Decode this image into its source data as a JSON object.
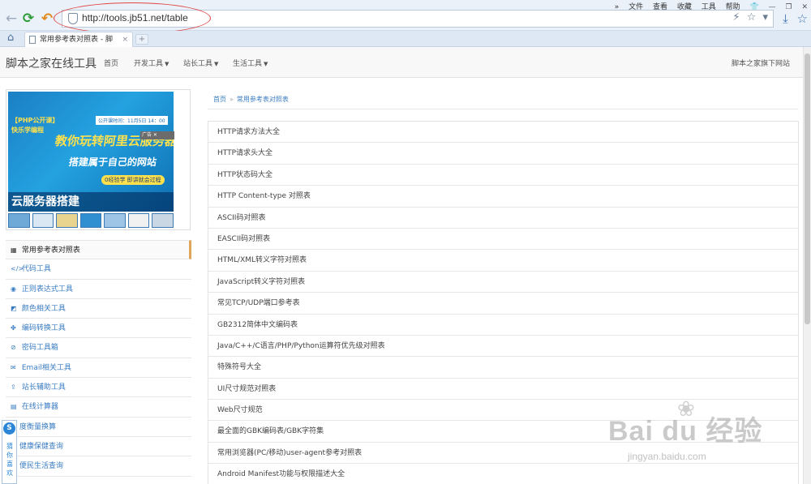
{
  "browser": {
    "url": "http://tools.jb51.net/table",
    "menu": [
      "文件",
      "查看",
      "收藏",
      "工具",
      "帮助"
    ],
    "menu_prefix": "»",
    "tab_title": "常用参考表对照表 - 脚",
    "tab_close": "×",
    "new_tab": "+",
    "icons": {
      "back": "←",
      "refresh": "⟳",
      "undo": "↶",
      "home": "⌂",
      "bolt": "⚡",
      "star": "☆",
      "dropdown": "▾",
      "download": "⤓",
      "favorites": "☆",
      "shirt": "👕",
      "minimize": "—",
      "restore": "❐",
      "close": "✕"
    }
  },
  "site": {
    "brand": "脚本之家在线工具",
    "nav": [
      "首页",
      "开发工具",
      "站长工具",
      "生活工具"
    ],
    "header_right": "脚本之家旗下网站"
  },
  "ad": {
    "tag_line1": "【PHP公开课】",
    "tag_line2": "快乐学编程",
    "date": "公开课时间：11月5日 14：00",
    "headline": "教你玩转阿里云服务器",
    "subline": "搭建属于自己的网站",
    "pill": "0经验学 即讲就会过程",
    "caption": "云服务器搭建",
    "badge": "广告 ✕"
  },
  "sidebar": {
    "items": [
      {
        "icon": "▦",
        "label": "常用参考表对照表"
      },
      {
        "icon": "</>",
        "label": "代码工具"
      },
      {
        "icon": "◉",
        "label": "正则表达式工具"
      },
      {
        "icon": "◩",
        "label": "颜色相关工具"
      },
      {
        "icon": "✤",
        "label": "编码转换工具"
      },
      {
        "icon": "⊘",
        "label": "密码工具箱"
      },
      {
        "icon": "✉",
        "label": "Email相关工具"
      },
      {
        "icon": "⇪",
        "label": "站长辅助工具"
      },
      {
        "icon": "▤",
        "label": "在线计算器"
      },
      {
        "icon": "",
        "label": "度衡量换算"
      },
      {
        "icon": "",
        "label": "健康保健查询"
      },
      {
        "icon": "",
        "label": "便民生活查询"
      }
    ]
  },
  "float_widget": {
    "logo": "S",
    "text": "猜你喜欢"
  },
  "breadcrumb": {
    "home": "首页",
    "sep": "»",
    "current": "常用参考表对照表"
  },
  "main": {
    "items": [
      "HTTP请求方法大全",
      "HTTP请求头大全",
      "HTTP状态码大全",
      "HTTP Content-type 对照表",
      "ASCII码对照表",
      "EASCII码对照表",
      "HTML/XML转义字符对照表",
      "JavaScript转义字符对照表",
      "常见TCP/UDP端口参考表",
      "GB2312简体中文编码表",
      "Java/C++/C语言/PHP/Python运算符优先级对照表",
      "特殊符号大全",
      "UI尺寸规范对照表",
      "Web尺寸规范",
      "最全面的GBK编码表/GBK字符集",
      "常用浏览器(PC/移动)user-agent参考对照表",
      "Android Manifest功能与权限描述大全"
    ]
  },
  "watermark": {
    "logo": "Bai du 经验",
    "url": "jingyan.baidu.com",
    "paw": "❀"
  }
}
